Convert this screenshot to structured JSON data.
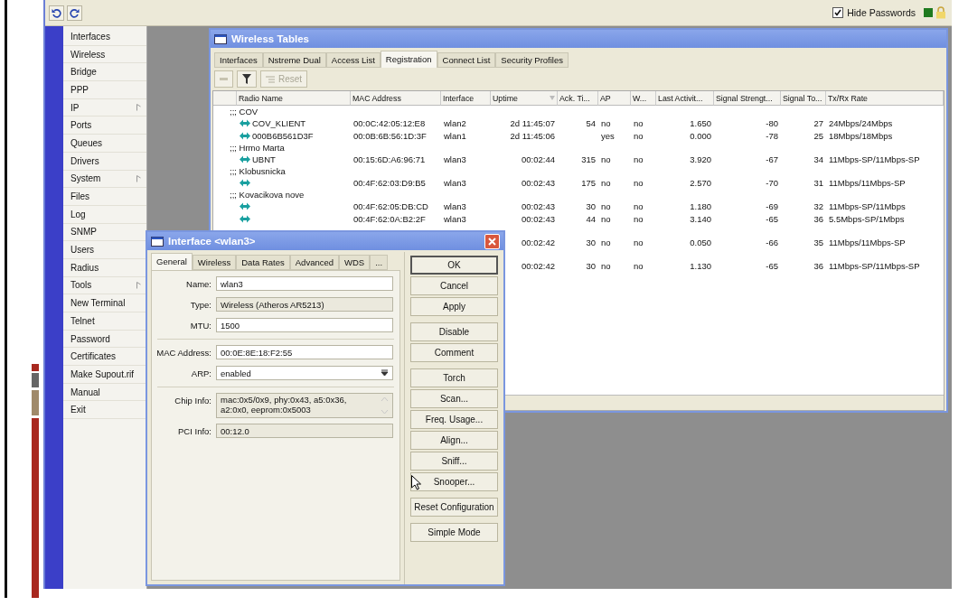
{
  "toolbar": {
    "hide_passwords": {
      "label": "Hide Passwords",
      "checked": true
    }
  },
  "sidebar": {
    "items": [
      {
        "label": "Interfaces",
        "submenu": false
      },
      {
        "label": "Wireless",
        "submenu": false
      },
      {
        "label": "Bridge",
        "submenu": false
      },
      {
        "label": "PPP",
        "submenu": false
      },
      {
        "label": "IP",
        "submenu": true
      },
      {
        "label": "Ports",
        "submenu": false
      },
      {
        "label": "Queues",
        "submenu": false
      },
      {
        "label": "Drivers",
        "submenu": false
      },
      {
        "label": "System",
        "submenu": true
      },
      {
        "label": "Files",
        "submenu": false
      },
      {
        "label": "Log",
        "submenu": false
      },
      {
        "label": "SNMP",
        "submenu": false
      },
      {
        "label": "Users",
        "submenu": false
      },
      {
        "label": "Radius",
        "submenu": false
      },
      {
        "label": "Tools",
        "submenu": true
      },
      {
        "label": "New Terminal",
        "submenu": false
      },
      {
        "label": "Telnet",
        "submenu": false
      },
      {
        "label": "Password",
        "submenu": false
      },
      {
        "label": "Certificates",
        "submenu": false
      },
      {
        "label": "Make Supout.rif",
        "submenu": false
      },
      {
        "label": "Manual",
        "submenu": false
      },
      {
        "label": "Exit",
        "submenu": false
      }
    ]
  },
  "wireless_window": {
    "title": "Wireless Tables",
    "tabs": [
      {
        "label": "Interfaces",
        "selected": false
      },
      {
        "label": "Nstreme Dual",
        "selected": false
      },
      {
        "label": "Access List",
        "selected": false
      },
      {
        "label": "Registration",
        "selected": true
      },
      {
        "label": "Connect List",
        "selected": false
      },
      {
        "label": "Security Profiles",
        "selected": false
      }
    ],
    "reset_button": {
      "label": "Reset",
      "disabled": true
    },
    "table": {
      "columns": [
        "Radio Name",
        "MAC Address",
        "Interface",
        "Uptime",
        "Ack. Ti...",
        "AP",
        "W...",
        "Last Activit...",
        "Signal Strengt...",
        "Signal To...",
        "Tx/Rx Rate"
      ],
      "rows": [
        {
          "kind": "comment",
          "text": ";;; COV"
        },
        {
          "kind": "entry",
          "cells": [
            "COV_KLIENT",
            "00:0C:42:05:12:E8",
            "wlan2",
            "2d 11:45:07",
            "54",
            "no",
            "no",
            "1.650",
            "-80",
            "27",
            "24Mbps/24Mbps"
          ]
        },
        {
          "kind": "entry",
          "cells": [
            "000B6B561D3F",
            "00:0B:6B:56:1D:3F",
            "wlan1",
            "2d 11:45:06",
            "",
            "yes",
            "no",
            "0.000",
            "-78",
            "25",
            "18Mbps/18Mbps"
          ]
        },
        {
          "kind": "comment",
          "text": ";;; Hrmo Marta"
        },
        {
          "kind": "entry",
          "cells": [
            "UBNT",
            "00:15:6D:A6:96:71",
            "wlan3",
            "00:02:44",
            "315",
            "no",
            "no",
            "3.920",
            "-67",
            "34",
            "11Mbps-SP/11Mbps-SP"
          ]
        },
        {
          "kind": "comment",
          "text": ";;; Klobusnicka"
        },
        {
          "kind": "entry",
          "cells": [
            "",
            "00:4F:62:03:D9:B5",
            "wlan3",
            "00:02:43",
            "175",
            "no",
            "no",
            "2.570",
            "-70",
            "31",
            "11Mbps/11Mbps-SP"
          ]
        },
        {
          "kind": "comment",
          "text": ";;; Kovacikova nove"
        },
        {
          "kind": "entry",
          "cells": [
            "",
            "00:4F:62:05:DB:CD",
            "wlan3",
            "00:02:43",
            "30",
            "no",
            "no",
            "1.180",
            "-69",
            "32",
            "11Mbps-SP/11Mbps"
          ]
        },
        {
          "kind": "entry",
          "cells": [
            "",
            "00:4F:62:0A:B2:2F",
            "wlan3",
            "00:02:43",
            "44",
            "no",
            "no",
            "3.140",
            "-65",
            "36",
            "5.5Mbps-SP/1Mbps"
          ]
        },
        {
          "kind": "covered"
        },
        {
          "kind": "partial",
          "cells": [
            "",
            "",
            "",
            "00:02:42",
            "30",
            "no",
            "no",
            "0.050",
            "-66",
            "35",
            "11Mbps/11Mbps-SP"
          ]
        },
        {
          "kind": "covered"
        },
        {
          "kind": "partial",
          "cells": [
            "",
            "",
            "",
            "00:02:42",
            "30",
            "no",
            "no",
            "1.130",
            "-65",
            "36",
            "11Mbps-SP/11Mbps-SP"
          ]
        }
      ]
    }
  },
  "interface_dialog": {
    "title": "Interface <wlan3>",
    "tabs": [
      {
        "label": "General",
        "selected": true
      },
      {
        "label": "Wireless",
        "selected": false
      },
      {
        "label": "Data Rates",
        "selected": false
      },
      {
        "label": "Advanced",
        "selected": false
      },
      {
        "label": "WDS",
        "selected": false
      },
      {
        "label": "...",
        "selected": false
      }
    ],
    "fields": [
      {
        "kind": "input",
        "label": "Name:",
        "value": "wlan3"
      },
      {
        "kind": "readonly",
        "label": "Type:",
        "value": "Wireless (Atheros AR5213)"
      },
      {
        "kind": "input",
        "label": "MTU:",
        "value": "1500"
      },
      {
        "kind": "divider"
      },
      {
        "kind": "input",
        "label": "MAC Address:",
        "value": "00:0E:8E:18:F2:55"
      },
      {
        "kind": "select",
        "label": "ARP:",
        "value": "enabled"
      },
      {
        "kind": "divider"
      },
      {
        "kind": "multiline",
        "label": "Chip Info:",
        "value": "mac:0x5/0x9, phy:0x43, a5:0x36, a2:0x0, eeprom:0x5003"
      },
      {
        "kind": "readonly",
        "label": "PCI Info:",
        "value": "00:12.0"
      }
    ],
    "button_groups": [
      [
        {
          "label": "OK",
          "default": true
        },
        {
          "label": "Cancel",
          "default": false
        },
        {
          "label": "Apply",
          "default": false
        }
      ],
      [
        {
          "label": "Disable",
          "default": false
        },
        {
          "label": "Comment",
          "default": false
        }
      ],
      [
        {
          "label": "Torch",
          "default": false
        },
        {
          "label": "Scan...",
          "default": false
        },
        {
          "label": "Freq. Usage...",
          "default": false
        },
        {
          "label": "Align...",
          "default": false
        },
        {
          "label": "Sniff...",
          "default": false
        },
        {
          "label": "Snooper...",
          "default": false
        }
      ],
      [
        {
          "label": "Reset Configuration",
          "default": false
        }
      ],
      [
        {
          "label": "Simple Mode",
          "default": false
        }
      ]
    ]
  }
}
